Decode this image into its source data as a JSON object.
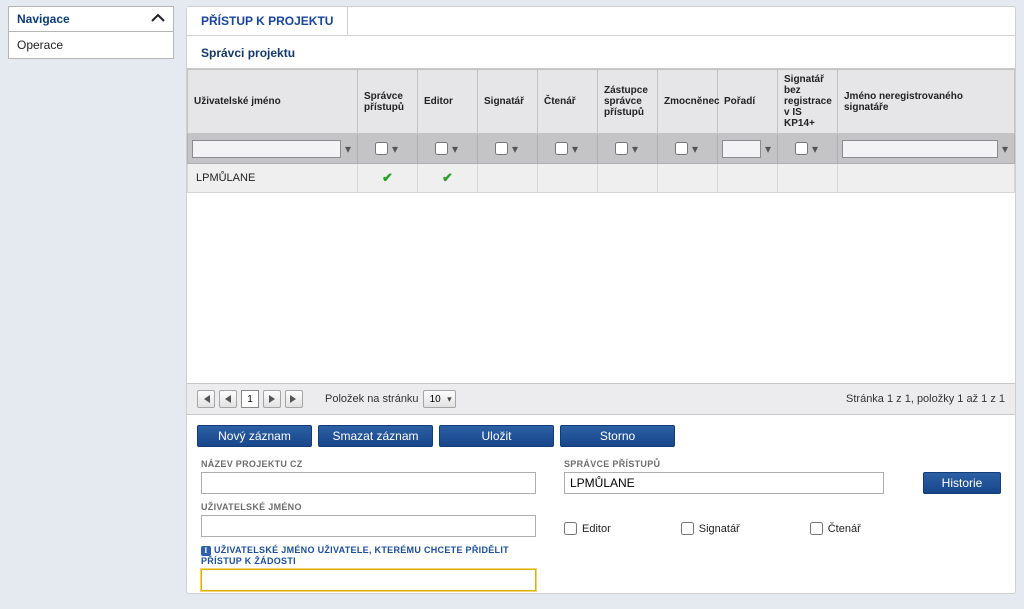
{
  "sidebar": {
    "header": "Navigace",
    "items": [
      "Operace"
    ]
  },
  "tab": {
    "title": "PŘÍSTUP K PROJEKTU"
  },
  "section": {
    "title": "Správci projektu"
  },
  "grid": {
    "columns": [
      "Uživatelské jméno",
      "Správce přístupů",
      "Editor",
      "Signatář",
      "Čtenář",
      "Zástupce správce přístupů",
      "Zmocněnec",
      "Pořadí",
      "Signatář bez registrace v IS KP14+",
      "Jméno neregistrovaného signatáře"
    ],
    "row": {
      "username": "LPMŮLANE",
      "spravce": true,
      "editor": true
    }
  },
  "pager": {
    "first": "⏮",
    "prev": "◀",
    "page": "1",
    "next": "▶",
    "last": "⏭",
    "per_page_label": "Položek na stránku",
    "per_page_value": "10",
    "status": "Stránka 1 z 1, položky 1 až 1 z 1"
  },
  "buttons": {
    "new": "Nový záznam",
    "delete": "Smazat záznam",
    "save": "Uložit",
    "cancel": "Storno",
    "history": "Historie"
  },
  "form": {
    "project_name_label": "NÁZEV PROJEKTU CZ",
    "project_name_value": "",
    "manager_label": "SPRÁVCE PŘÍSTUPŮ",
    "manager_value": "LPMŮLANE",
    "username_label": "UŽIVATELSKÉ JMÉNO",
    "username_value": "",
    "editor_label": "Editor",
    "signatar_label": "Signatář",
    "ctenar_label": "Čtenář",
    "assign_label": "UŽIVATELSKÉ JMÉNO UŽIVATELE, KTERÉMU CHCETE PŘIDĚLIT PŘÍSTUP K ŽÁDOSTI",
    "assign_value": ""
  }
}
